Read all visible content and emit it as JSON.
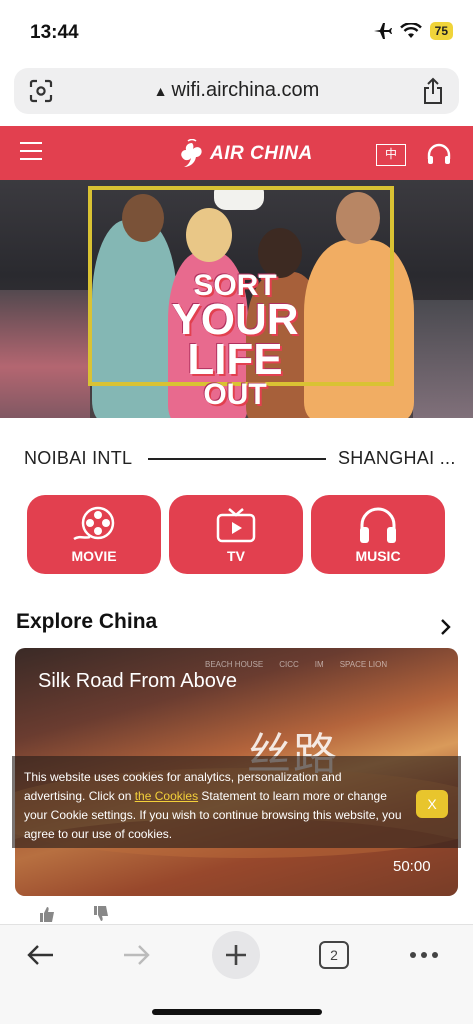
{
  "status_bar": {
    "time": "13:44",
    "battery": "75"
  },
  "browser": {
    "url": "wifi.airchina.com",
    "tab_count": "2"
  },
  "header": {
    "logo_text": "AIR CHINA",
    "language_label": "中"
  },
  "banner": {
    "title_lines": [
      "SORT",
      "YOUR",
      "LIFE",
      "OUT"
    ]
  },
  "route": {
    "from": "NOIBAI INTL",
    "to": "SHANGHAI ..."
  },
  "categories": [
    {
      "label": "MOVIE",
      "icon": "film-reel-icon"
    },
    {
      "label": "TV",
      "icon": "tv-icon"
    },
    {
      "label": "MUSIC",
      "icon": "headphones-icon"
    }
  ],
  "explore": {
    "title": "Explore China",
    "video": {
      "title": "Silk Road From Above",
      "overlay_text": "丝路",
      "duration": "50:00",
      "partner_logos": [
        "BEACH HOUSE",
        "CICC",
        "IM",
        "SPACE LION"
      ]
    }
  },
  "cookie": {
    "text_before": "This website uses cookies for analytics, personalization and advertising. Click on ",
    "link": "the Cookies",
    "text_after": " Statement to learn more or change your Cookie settings. If you wish to continue browsing this website, you agree to our use of cookies.",
    "close_label": "X"
  },
  "colors": {
    "brand_red": "#e2404f",
    "cookie_accent": "#e8c52d"
  }
}
